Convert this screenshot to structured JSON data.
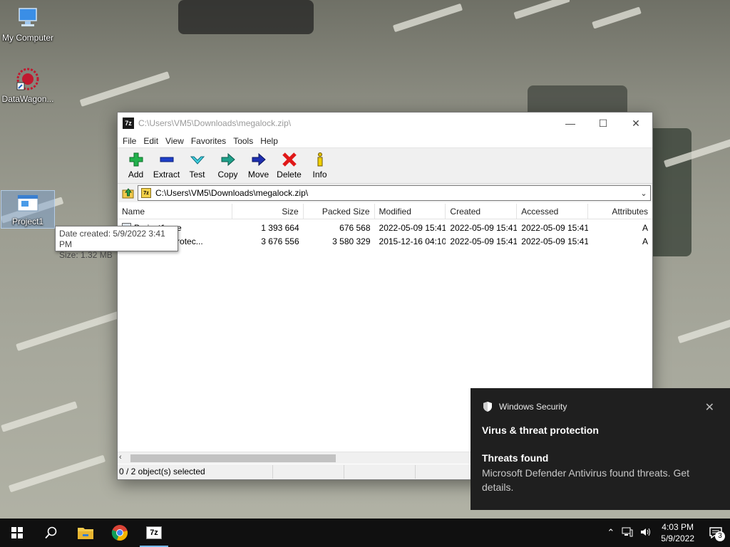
{
  "desktop": {
    "icons": [
      {
        "label": "My Computer",
        "icon": "computer-icon"
      },
      {
        "label": "DataWagon...",
        "icon": "datawagon-icon"
      },
      {
        "label": "Project1",
        "icon": "exe-file-icon"
      }
    ],
    "tooltip": {
      "line1": "Date created: 5/9/2022 3:41 PM",
      "line2": "Size: 1.32 MB"
    }
  },
  "window": {
    "title": "C:\\Users\\VM5\\Downloads\\megalock.zip\\",
    "app_icon": "7z",
    "menu": [
      "File",
      "Edit",
      "View",
      "Favorites",
      "Tools",
      "Help"
    ],
    "toolbar": [
      {
        "label": "Add",
        "icon": "plus-icon"
      },
      {
        "label": "Extract",
        "icon": "minus-icon"
      },
      {
        "label": "Test",
        "icon": "check-icon"
      },
      {
        "label": "Copy",
        "icon": "copy-arrow-icon"
      },
      {
        "label": "Move",
        "icon": "move-arrow-icon"
      },
      {
        "label": "Delete",
        "icon": "delete-x-icon"
      },
      {
        "label": "Info",
        "icon": "info-icon"
      }
    ],
    "address": "C:\\Users\\VM5\\Downloads\\megalock.zip\\",
    "columns": [
      "Name",
      "Size",
      "Packed Size",
      "Modified",
      "Created",
      "Accessed",
      "Attributes"
    ],
    "rows": [
      {
        "name": "Project1.exe",
        "size": "1 393 664",
        "packed": "676 568",
        "modified": "2022-05-09 15:41",
        "created": "2022-05-09 15:41",
        "accessed": "2022-05-09 15:41",
        "attr": "A"
      },
      {
        "name": "Windows Protec...",
        "size": "3 676 556",
        "packed": "3 580 329",
        "modified": "2015-12-16 04:10",
        "created": "2022-05-09 15:41",
        "accessed": "2022-05-09 15:41",
        "attr": "A"
      }
    ],
    "status": "0 / 2 object(s) selected"
  },
  "toast": {
    "app": "Windows Security",
    "heading": "Virus & threat protection",
    "subheading": "Threats found",
    "body": "Microsoft Defender Antivirus found threats. Get details."
  },
  "taskbar": {
    "items": [
      "start-icon",
      "search-icon",
      "file-explorer-icon",
      "chrome-icon",
      "7zip-icon"
    ],
    "seven_zip_label": "7z",
    "clock_time": "4:03 PM",
    "clock_date": "5/9/2022",
    "notification_count": "3"
  }
}
